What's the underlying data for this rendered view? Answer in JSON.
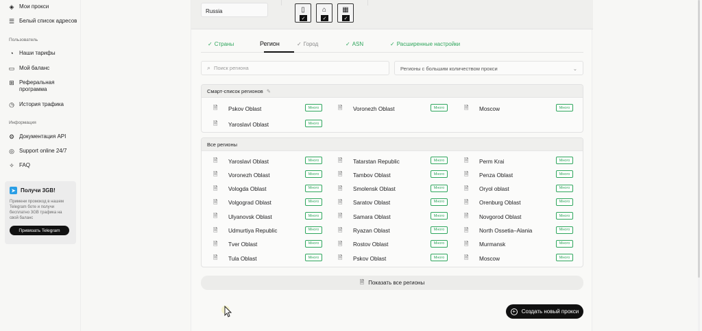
{
  "sidebar": {
    "items_top": [
      {
        "label": "Мои прокси",
        "icon": "layers-icon"
      },
      {
        "label": "Белый список адресов",
        "icon": "list-icon"
      }
    ],
    "section_user": "Пользователь",
    "items_user": [
      {
        "label": "Наши тарифы",
        "icon": "tariff-icon"
      },
      {
        "label": "Мой баланс",
        "icon": "wallet-icon"
      },
      {
        "label": "Реферальная программа",
        "icon": "gift-icon"
      },
      {
        "label": "История трафика",
        "icon": "history-icon"
      }
    ],
    "section_info": "Информация",
    "items_info": [
      {
        "label": "Документация API",
        "icon": "gear-icon"
      },
      {
        "label": "Support online 24/7",
        "icon": "chat-icon"
      },
      {
        "label": "FAQ",
        "icon": "sparkle-icon"
      }
    ],
    "promo": {
      "title": "Получи 3GB!",
      "text": "Примени промокод в нашем Telegram боте и получи бесплатно 3GB трафика на свой баланс",
      "button": "Привязать Telegram"
    }
  },
  "form": {
    "country_value": "Russia",
    "device_icons": [
      "phone-icon",
      "home-icon",
      "building-icon"
    ]
  },
  "tabs": [
    {
      "label": "Страны",
      "state": "checked"
    },
    {
      "label": "Регион",
      "state": "active"
    },
    {
      "label": "Город",
      "state": "grey"
    },
    {
      "label": "ASN",
      "state": "checked"
    },
    {
      "label": "Расширенные настройки",
      "state": "checked"
    }
  ],
  "search": {
    "placeholder": "Поиск региона"
  },
  "filter": {
    "selected": "Регионы с большим количеством прокси"
  },
  "smart_list": {
    "title": "Смарт-список регионов",
    "regions": [
      "Pskov Oblast",
      "Voronezh Oblast",
      "Moscow",
      "Yaroslavl Oblast"
    ]
  },
  "all_regions": {
    "title": "Все регионы",
    "regions": [
      "Yaroslavl Oblast",
      "Tatarstan Republic",
      "Perm Krai",
      "Voronezh Oblast",
      "Tambov Oblast",
      "Penza Oblast",
      "Vologda Oblast",
      "Smolensk Oblast",
      "Oryol oblast",
      "Volgograd Oblast",
      "Saratov Oblast",
      "Orenburg Oblast",
      "Ulyanovsk Oblast",
      "Samara Oblast",
      "Novgorod Oblast",
      "Udmurtiya Republic",
      "Ryazan Oblast",
      "North Ossetia–Alania",
      "Tver Oblast",
      "Rostov Oblast",
      "Murmansk",
      "Tula Oblast",
      "Pskov Oblast",
      "Moscow"
    ]
  },
  "badge_label": "Много",
  "buttons": {
    "show_all": "Показать все регионы",
    "create": "Создать новый прокси"
  },
  "colors": {
    "accent": "#2da55b",
    "dark": "#111111"
  }
}
